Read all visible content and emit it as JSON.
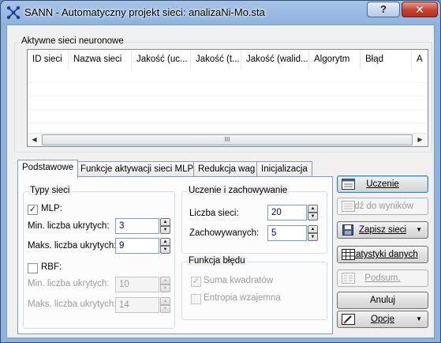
{
  "window": {
    "title": "SANN - Automatyczny projekt sieci: analizaNi-Mo.sta",
    "help_label": "?",
    "close_label": "✕"
  },
  "networks_group": {
    "label": "Aktywne sieci neuronowe",
    "columns": [
      "ID sieci",
      "Nazwa sieci",
      "Jakość (uc...",
      "Jakość (t...",
      "Jakość (walid...",
      "Algorytm",
      "Błąd",
      "A"
    ],
    "rows": [],
    "scroll_left": "◀",
    "scroll_right": "▶",
    "scroll_grip": "III"
  },
  "tabs": [
    {
      "label": "Podstawowe",
      "active": true
    },
    {
      "label": "Funkcje aktywacji sieci MLP",
      "active": false
    },
    {
      "label": "Redukcja wag",
      "active": false
    },
    {
      "label": "Inicjalizacja",
      "active": false
    }
  ],
  "network_types": {
    "label": "Typy sieci",
    "mlp": {
      "label": "MLP:",
      "checked": true,
      "check_mark": "✓"
    },
    "mlp_min": {
      "label": "Min. liczba ukrytych:",
      "value": "3"
    },
    "mlp_max": {
      "label": "Maks. liczba ukrytych:",
      "value": "9"
    },
    "rbf": {
      "label": "RBF:",
      "checked": false
    },
    "rbf_min": {
      "label": "Min. liczba ukrytych:",
      "value": "10"
    },
    "rbf_max": {
      "label": "Maks. liczba ukrytych:",
      "value": "14"
    }
  },
  "training": {
    "label": "Uczenie i zachowywanie",
    "networks": {
      "label": "Liczba sieci:",
      "value": "20"
    },
    "retained": {
      "label": "Zachowywanych:",
      "value": "5"
    }
  },
  "error_function": {
    "label": "Funkcja błędu",
    "sum_squares": {
      "label": "Suma kwadratów",
      "checked": true,
      "check_mark": "✓"
    },
    "entropy": {
      "label": "Entropia wzajemna",
      "checked": false
    }
  },
  "buttons": {
    "train": "Uczenie",
    "goto_results": "Idź do wyników",
    "save_networks": "Zapisz sieci",
    "data_statistics": "Statystyki danych",
    "summary": "Podsum.",
    "cancel": "Anuluj",
    "options": "Opcje"
  },
  "spinner": {
    "up": "▲",
    "down": "▼",
    "dropdown": "▼"
  },
  "colors": {
    "title_bg": "#8fb2dd",
    "close_red": "#c6412f",
    "input_text": "#000080"
  }
}
